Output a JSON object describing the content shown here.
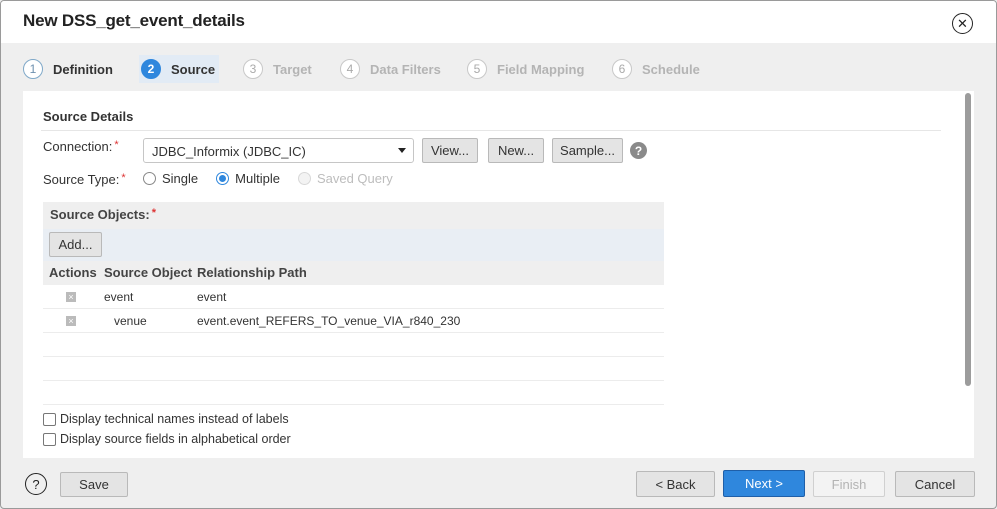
{
  "dialog": {
    "title": "New DSS_get_event_details",
    "close_icon": "close-circle-icon"
  },
  "steps": [
    {
      "num": "1",
      "label": "Definition",
      "state": "done"
    },
    {
      "num": "2",
      "label": "Source",
      "state": "active"
    },
    {
      "num": "3",
      "label": "Target",
      "state": "pending"
    },
    {
      "num": "4",
      "label": "Data Filters",
      "state": "pending"
    },
    {
      "num": "5",
      "label": "Field Mapping",
      "state": "pending"
    },
    {
      "num": "6",
      "label": "Schedule",
      "state": "pending"
    }
  ],
  "source": {
    "section_title": "Source Details",
    "connection_label": "Connection:",
    "connection_value": "JDBC_Informix (JDBC_IC)",
    "view_button": "View...",
    "new_button": "New...",
    "sample_button": "Sample...",
    "help_icon": "?",
    "source_type_label": "Source Type:",
    "source_type_options": [
      {
        "label": "Single",
        "checked": false,
        "disabled": false
      },
      {
        "label": "Multiple",
        "checked": true,
        "disabled": false
      },
      {
        "label": "Saved Query",
        "checked": false,
        "disabled": true
      }
    ],
    "required_mark": "*",
    "objects_label": "Source Objects:",
    "add_button": "Add...",
    "table": {
      "columns": [
        "Actions",
        "Source Object",
        "Relationship Path"
      ],
      "rows": [
        {
          "object": "event",
          "path": "event"
        },
        {
          "object": "venue",
          "path": "event.event_REFERS_TO_venue_VIA_r840_230"
        }
      ]
    },
    "checkboxes": [
      {
        "label": "Display technical names instead of labels",
        "checked": false
      },
      {
        "label": "Display source fields in alphabetical order",
        "checked": false
      }
    ]
  },
  "footer": {
    "help_icon": "?",
    "save": "Save",
    "back": "< Back",
    "next": "Next >",
    "finish": "Finish",
    "cancel": "Cancel"
  },
  "colors": {
    "accent": "#2f87dd",
    "required": "#dd3333"
  }
}
